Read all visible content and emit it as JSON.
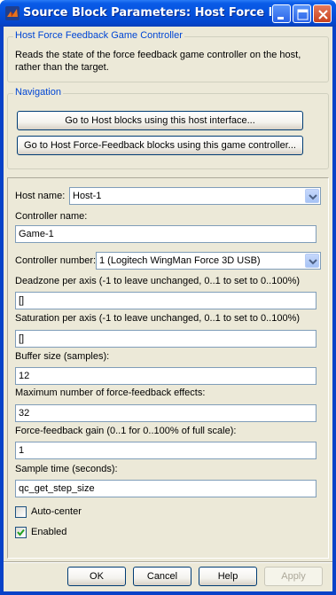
{
  "window": {
    "title": "Source Block Parameters: Host Force Feed..."
  },
  "description_group": {
    "title": "Host Force Feedback Game Controller",
    "text": "Reads the state of the force feedback game controller on the host,\nrather than the target."
  },
  "navigation": {
    "title": "Navigation",
    "button1": "Go to Host blocks using this host interface...",
    "button2": "Go to Host Force-Feedback blocks using this game controller..."
  },
  "params": {
    "host_name_label": "Host name:",
    "host_name_value": "Host-1",
    "controller_name_label": "Controller name:",
    "controller_name_value": "Game-1",
    "controller_number_label": "Controller number:",
    "controller_number_value": "1   (Logitech WingMan Force 3D USB)",
    "deadzone_label": "Deadzone per axis (-1 to leave unchanged, 0..1 to set to 0..100%)",
    "deadzone_value": "[]",
    "saturation_label": "Saturation per axis (-1 to leave unchanged, 0..1 to set to 0..100%)",
    "saturation_value": "[]",
    "buffer_label": "Buffer size (samples):",
    "buffer_value": "12",
    "max_effects_label": "Maximum number of force-feedback effects:",
    "max_effects_value": "32",
    "gain_label": "Force-feedback gain (0..1 for 0..100% of full scale):",
    "gain_value": "1",
    "sample_time_label": "Sample time (seconds):",
    "sample_time_value": "qc_get_step_size",
    "auto_center_label": "Auto-center",
    "auto_center_checked": false,
    "enabled_label": "Enabled",
    "enabled_checked": true
  },
  "footer": {
    "ok": "OK",
    "cancel": "Cancel",
    "help": "Help",
    "apply": "Apply"
  }
}
